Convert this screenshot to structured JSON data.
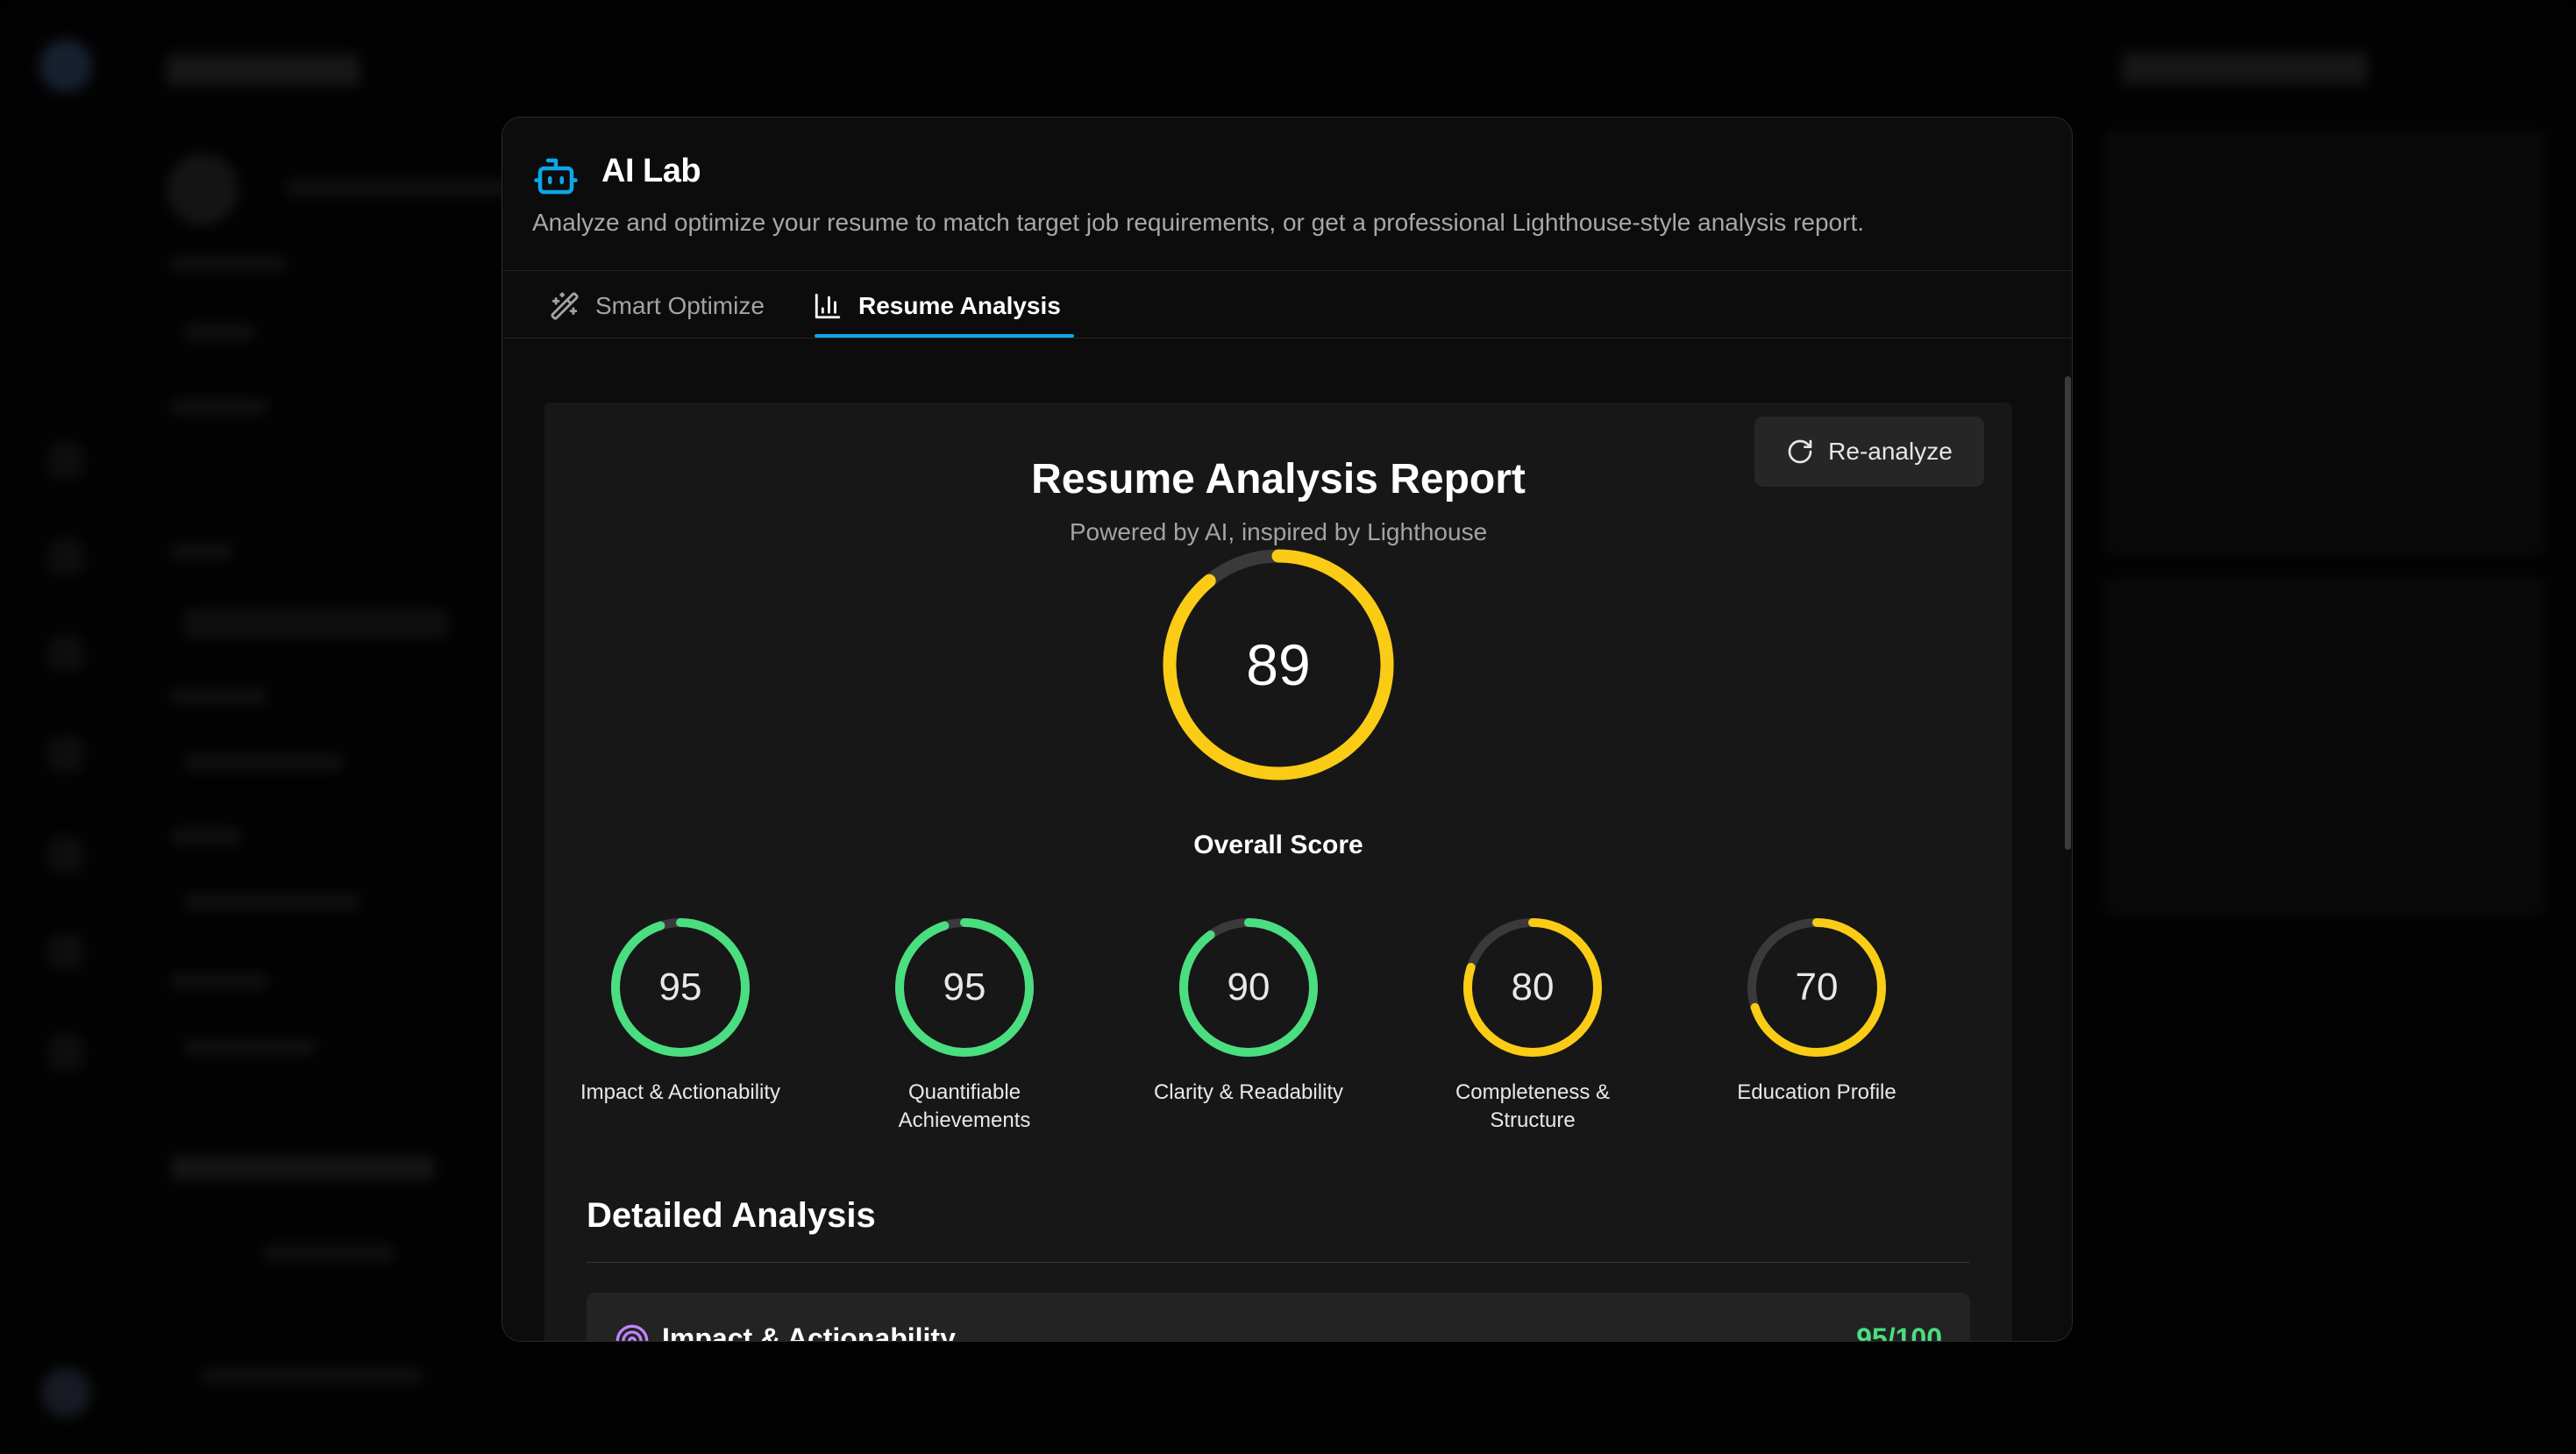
{
  "dialog": {
    "title": "AI Lab",
    "description": "Analyze and optimize your resume to match target job requirements, or get a professional Lighthouse-style analysis report.",
    "icon": "robot-icon"
  },
  "tabs": [
    {
      "label": "Smart Optimize",
      "icon": "magic-wand-icon",
      "active": false
    },
    {
      "label": "Resume Analysis",
      "icon": "bar-chart-icon",
      "active": true
    }
  ],
  "report": {
    "reanalyze_label": "Re-analyze",
    "title": "Resume Analysis Report",
    "subtitle": "Powered by AI, inspired by Lighthouse",
    "overall": {
      "score": 89,
      "label": "Overall Score",
      "color": "#facc15"
    },
    "categories": [
      {
        "score": 95,
        "label": "Impact & Actionability",
        "color": "#4ade80"
      },
      {
        "score": 95,
        "label": "Quantifiable Achievements",
        "color": "#4ade80"
      },
      {
        "score": 90,
        "label": "Clarity & Readability",
        "color": "#4ade80"
      },
      {
        "score": 80,
        "label": "Completeness & Structure",
        "color": "#facc15"
      },
      {
        "score": 70,
        "label": "Education Profile",
        "color": "#facc15"
      }
    ],
    "detailed_title": "Detailed Analysis",
    "detail_items": [
      {
        "title": "Impact & Actionability",
        "score_text": "95/100",
        "icon": "fingerprint-icon"
      }
    ]
  },
  "colors": {
    "accent": "#0ea5e9",
    "good": "#4ade80",
    "average": "#facc15",
    "track": "#3a3a3a"
  }
}
